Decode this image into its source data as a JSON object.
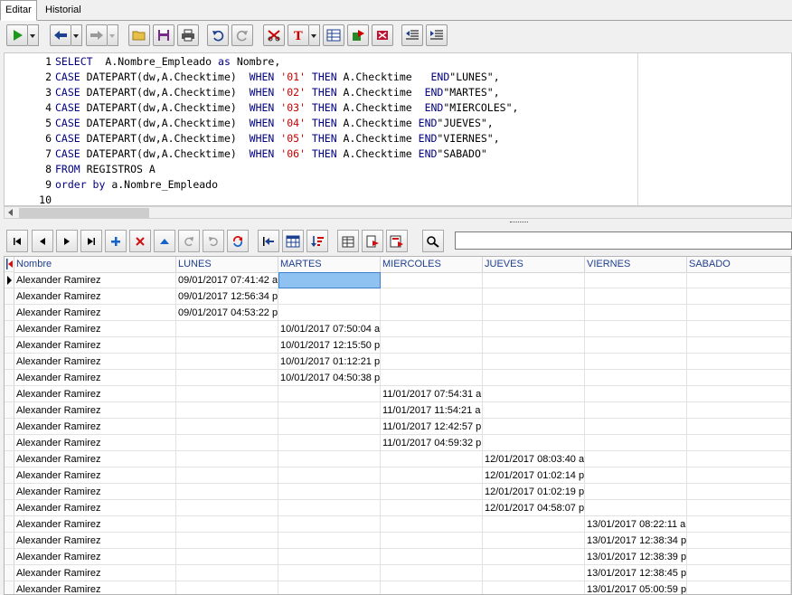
{
  "tabs": {
    "editar": "Editar",
    "historial": "Historial"
  },
  "editor": {
    "lines": [
      {
        "n": "1",
        "parts": [
          [
            "kw",
            "SELECT "
          ],
          [
            "t",
            " A.Nombre_Empleado "
          ],
          [
            "kw",
            "as"
          ],
          [
            "t",
            " Nombre,"
          ]
        ]
      },
      {
        "n": "2",
        "parts": [
          [
            "kw",
            "CASE"
          ],
          [
            "t",
            " DATEPART(dw,A.Checktime)  "
          ],
          [
            "kw",
            "WHEN"
          ],
          [
            "t",
            " "
          ],
          [
            "str",
            "'01'"
          ],
          [
            "t",
            " "
          ],
          [
            "kw",
            "THEN"
          ],
          [
            "t",
            " A.Checktime   "
          ],
          [
            "kw",
            "END"
          ],
          [
            "t",
            "\"LUNES\","
          ]
        ]
      },
      {
        "n": "3",
        "parts": [
          [
            "kw",
            "CASE"
          ],
          [
            "t",
            " DATEPART(dw,A.Checktime)  "
          ],
          [
            "kw",
            "WHEN"
          ],
          [
            "t",
            " "
          ],
          [
            "str",
            "'02'"
          ],
          [
            "t",
            " "
          ],
          [
            "kw",
            "THEN"
          ],
          [
            "t",
            " A.Checktime  "
          ],
          [
            "kw",
            "END"
          ],
          [
            "t",
            "\"MARTES\","
          ]
        ]
      },
      {
        "n": "4",
        "parts": [
          [
            "kw",
            "CASE"
          ],
          [
            "t",
            " DATEPART(dw,A.Checktime)  "
          ],
          [
            "kw",
            "WHEN"
          ],
          [
            "t",
            " "
          ],
          [
            "str",
            "'03'"
          ],
          [
            "t",
            " "
          ],
          [
            "kw",
            "THEN"
          ],
          [
            "t",
            " A.Checktime  "
          ],
          [
            "kw",
            "END"
          ],
          [
            "t",
            "\"MIERCOLES\","
          ]
        ]
      },
      {
        "n": "5",
        "parts": [
          [
            "kw",
            "CASE"
          ],
          [
            "t",
            " DATEPART(dw,A.Checktime)  "
          ],
          [
            "kw",
            "WHEN"
          ],
          [
            "t",
            " "
          ],
          [
            "str",
            "'04'"
          ],
          [
            "t",
            " "
          ],
          [
            "kw",
            "THEN"
          ],
          [
            "t",
            " A.Checktime "
          ],
          [
            "kw",
            "END"
          ],
          [
            "t",
            "\"JUEVES\","
          ]
        ]
      },
      {
        "n": "6",
        "parts": [
          [
            "kw",
            "CASE"
          ],
          [
            "t",
            " DATEPART(dw,A.Checktime)  "
          ],
          [
            "kw",
            "WHEN"
          ],
          [
            "t",
            " "
          ],
          [
            "str",
            "'05'"
          ],
          [
            "t",
            " "
          ],
          [
            "kw",
            "THEN"
          ],
          [
            "t",
            " A.Checktime "
          ],
          [
            "kw",
            "END"
          ],
          [
            "t",
            "\"VIERNES\","
          ]
        ]
      },
      {
        "n": "7",
        "parts": [
          [
            "kw",
            "CASE"
          ],
          [
            "t",
            " DATEPART(dw,A.Checktime)  "
          ],
          [
            "kw",
            "WHEN"
          ],
          [
            "t",
            " "
          ],
          [
            "str",
            "'06'"
          ],
          [
            "t",
            " "
          ],
          [
            "kw",
            "THEN"
          ],
          [
            "t",
            " A.Checktime "
          ],
          [
            "kw",
            "END"
          ],
          [
            "t",
            "\"SABADO\""
          ]
        ]
      },
      {
        "n": "8",
        "parts": [
          [
            "kw",
            "FROM"
          ],
          [
            "t",
            " REGISTROS A"
          ]
        ]
      },
      {
        "n": "9",
        "parts": [
          [
            "kw",
            "order by"
          ],
          [
            "t",
            " a.Nombre_Empleado"
          ]
        ]
      },
      {
        "n": "10",
        "parts": []
      }
    ]
  },
  "filter": {
    "value": ""
  },
  "grid": {
    "columns": [
      "Nombre",
      "LUNES",
      "MARTES",
      "MIERCOLES",
      "JUEVES",
      "VIERNES",
      "SABADO"
    ],
    "rows": [
      [
        "Alexander Ramirez",
        "09/01/2017 07:41:42 a",
        "",
        "",
        "",
        "",
        ""
      ],
      [
        "Alexander Ramirez",
        "09/01/2017 12:56:34 p",
        "",
        "",
        "",
        "",
        ""
      ],
      [
        "Alexander Ramirez",
        "09/01/2017 04:53:22 p",
        "",
        "",
        "",
        "",
        ""
      ],
      [
        "Alexander Ramirez",
        "",
        "10/01/2017 07:50:04 a",
        "",
        "",
        "",
        ""
      ],
      [
        "Alexander Ramirez",
        "",
        "10/01/2017 12:15:50 p",
        "",
        "",
        "",
        ""
      ],
      [
        "Alexander Ramirez",
        "",
        "10/01/2017 01:12:21 p",
        "",
        "",
        "",
        ""
      ],
      [
        "Alexander Ramirez",
        "",
        "10/01/2017 04:50:38 p",
        "",
        "",
        "",
        ""
      ],
      [
        "Alexander Ramirez",
        "",
        "",
        "11/01/2017 07:54:31 a",
        "",
        "",
        ""
      ],
      [
        "Alexander Ramirez",
        "",
        "",
        "11/01/2017 11:54:21 a",
        "",
        "",
        ""
      ],
      [
        "Alexander Ramirez",
        "",
        "",
        "11/01/2017 12:42:57 p",
        "",
        "",
        ""
      ],
      [
        "Alexander Ramirez",
        "",
        "",
        "11/01/2017 04:59:32 p",
        "",
        "",
        ""
      ],
      [
        "Alexander Ramirez",
        "",
        "",
        "",
        "12/01/2017 08:03:40 a",
        "",
        ""
      ],
      [
        "Alexander Ramirez",
        "",
        "",
        "",
        "12/01/2017 01:02:14 p",
        "",
        ""
      ],
      [
        "Alexander Ramirez",
        "",
        "",
        "",
        "12/01/2017 01:02:19 p",
        "",
        ""
      ],
      [
        "Alexander Ramirez",
        "",
        "",
        "",
        "12/01/2017 04:58:07 p",
        "",
        ""
      ],
      [
        "Alexander Ramirez",
        "",
        "",
        "",
        "",
        "13/01/2017 08:22:11 a",
        ""
      ],
      [
        "Alexander Ramirez",
        "",
        "",
        "",
        "",
        "13/01/2017 12:38:34 p",
        ""
      ],
      [
        "Alexander Ramirez",
        "",
        "",
        "",
        "",
        "13/01/2017 12:38:39 p",
        ""
      ],
      [
        "Alexander Ramirez",
        "",
        "",
        "",
        "",
        "13/01/2017 12:38:45 p",
        ""
      ],
      [
        "Alexander Ramirez",
        "",
        "",
        "",
        "",
        "13/01/2017 05:00:59 p",
        ""
      ]
    ]
  }
}
